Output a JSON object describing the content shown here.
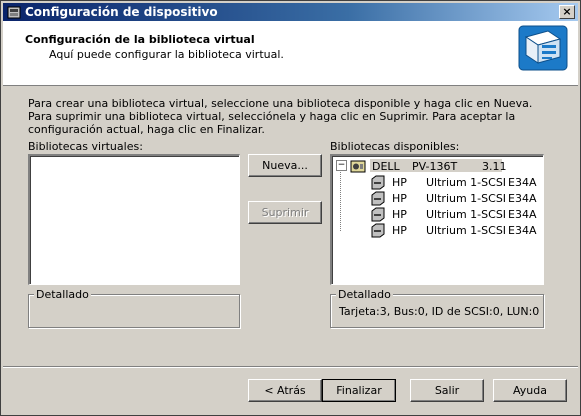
{
  "window": {
    "title": "Configuración de dispositivo",
    "close_label": "×"
  },
  "header": {
    "title": "Configuración de la biblioteca virtual",
    "subtitle": "Aquí puede configurar la biblioteca virtual."
  },
  "instructions": "Para crear una biblioteca virtual, seleccione una biblioteca disponible y haga clic en Nueva. Para suprimir una biblioteca virtual, selecciónela y haga clic en Suprimir. Para aceptar la configuración actual, haga clic en Finalizar.",
  "virtual": {
    "label": "Bibliotecas virtuales:",
    "detail_legend": "Detallado",
    "detail_text": ""
  },
  "middle": {
    "new_label": "Nueva...",
    "delete_label": "Suprimir"
  },
  "available": {
    "label": "Bibliotecas disponibles:",
    "library": {
      "expander": "−",
      "vendor": "DELL",
      "model": "PV-136T",
      "revision": "3.11"
    },
    "drives": [
      {
        "vendor": "HP",
        "model": "Ultrium 1-SCSI",
        "revision": "E34A"
      },
      {
        "vendor": "HP",
        "model": "Ultrium 1-SCSI",
        "revision": "E34A"
      },
      {
        "vendor": "HP",
        "model": "Ultrium 1-SCSI",
        "revision": "E34A"
      },
      {
        "vendor": "HP",
        "model": "Ultrium 1-SCSI",
        "revision": "E34A"
      }
    ],
    "detail_legend": "Detallado",
    "detail_text": "Tarjeta:3, Bus:0, ID de SCSI:0, LUN:0"
  },
  "footer": {
    "back_label": "< Atrás",
    "finish_label": "Finalizar",
    "exit_label": "Salir",
    "help_label": "Ayuda"
  },
  "colors": {
    "titlebar_start": "#0a246a",
    "titlebar_end": "#a6caf0",
    "face": "#d4d0c8"
  },
  "icons": {
    "app": "media-changer-icon",
    "logo": "tape-library-graphic-icon",
    "library": "tape-library-icon",
    "drive": "tape-drive-icon"
  }
}
